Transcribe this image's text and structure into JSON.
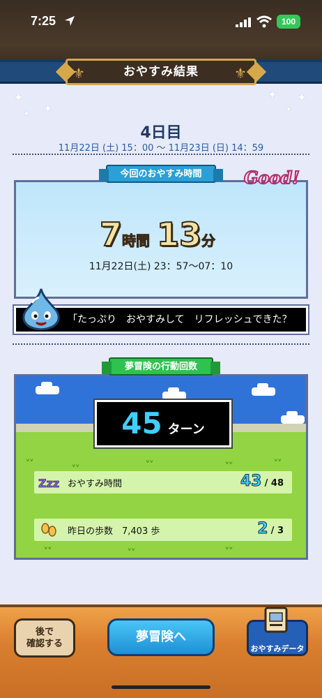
{
  "status_bar": {
    "time": "7:25",
    "battery": "100"
  },
  "header": {
    "title": "おやすみ結果"
  },
  "day": {
    "title": "4日目",
    "range": "11月22日 (土) 15：00 ～ 11月23日 (日) 14：59"
  },
  "sleep": {
    "ribbon": "今回のおやすみ時間",
    "badge": "Good!",
    "hours": "7",
    "hours_unit": "時間",
    "minutes": "13",
    "minutes_unit": "分",
    "range": "11月22日(土) 23：57～07：10"
  },
  "message": "「たっぷり　おやすみして　リフレッシュできた？",
  "adventure": {
    "ribbon": "夢冒険の行動回数",
    "turns": "45",
    "turns_unit": "ターン",
    "rows": [
      {
        "label": "おやすみ時間",
        "current": "43",
        "max": "/ 48",
        "icon": "zzz-icon"
      },
      {
        "label": "昨日の歩数　7,403 歩",
        "current": "2",
        "max": "/ 3",
        "icon": "footprints-icon"
      }
    ]
  },
  "buttons": {
    "later_line1": "後で",
    "later_line2": "確認する",
    "adventure": "夢冒険へ",
    "data": "おやすみデータ"
  },
  "colors": {
    "accent_blue": "#1f4a7a",
    "wood": "#d97f2f",
    "turn_cyan": "#3fd0ff"
  }
}
